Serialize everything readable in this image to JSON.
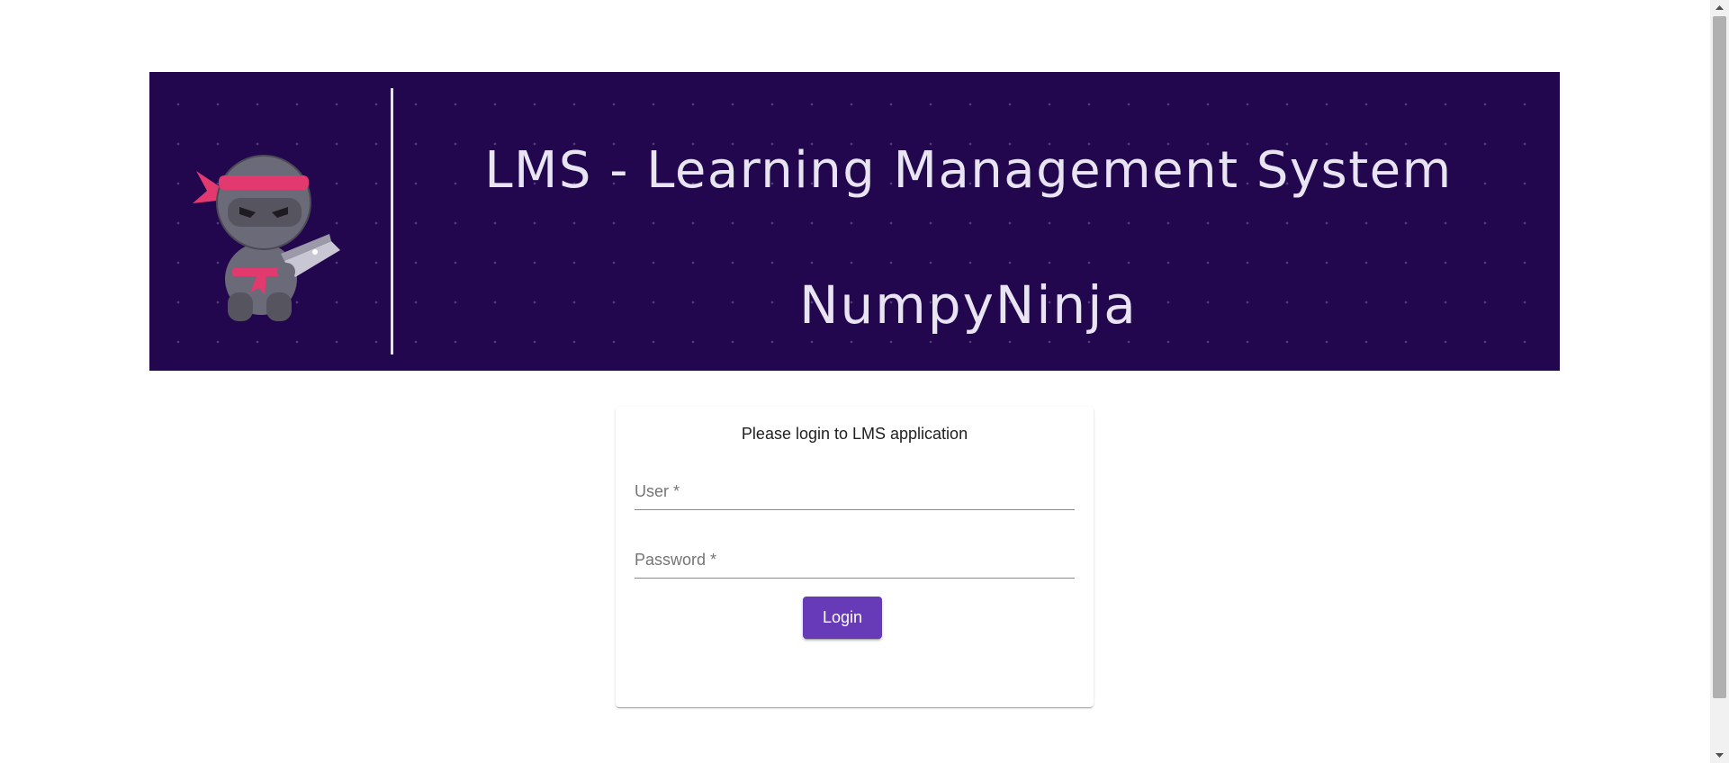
{
  "banner": {
    "title": "LMS - Learning Management System",
    "brand": "NumpyNinja",
    "logo_icon": "ninja-icon",
    "background_color": "#22074e",
    "text_color": "#e9e4f2"
  },
  "login": {
    "heading": "Please login to LMS application",
    "user_label": "User *",
    "password_label": "Password *",
    "submit_label": "Login",
    "button_color": "#673ab7"
  },
  "scrollbar": {
    "up_icon": "scroll-up-arrow-icon",
    "down_icon": "scroll-down-arrow-icon"
  }
}
